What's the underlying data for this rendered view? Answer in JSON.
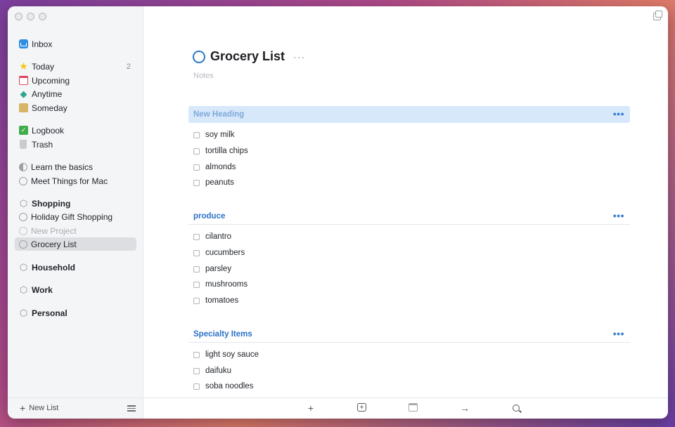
{
  "sidebar": {
    "items": [
      {
        "label": "Inbox",
        "icon": "inbox-icon"
      },
      {
        "label": "Today",
        "icon": "star-icon",
        "count": "2"
      },
      {
        "label": "Upcoming",
        "icon": "calendar-icon"
      },
      {
        "label": "Anytime",
        "icon": "stack-icon"
      },
      {
        "label": "Someday",
        "icon": "box-icon"
      },
      {
        "label": "Logbook",
        "icon": "logbook-icon"
      },
      {
        "label": "Trash",
        "icon": "trash-icon"
      },
      {
        "label": "Learn the basics",
        "icon": "progress-ring-icon"
      },
      {
        "label": "Meet Things for Mac",
        "icon": "ring-icon"
      },
      {
        "label": "Shopping",
        "icon": "cube-icon"
      },
      {
        "label": "Holiday Gift Shopping",
        "icon": "ring-icon"
      },
      {
        "label": "New Project",
        "icon": "ring-icon"
      },
      {
        "label": "Grocery List",
        "icon": "ring-icon"
      },
      {
        "label": "Household",
        "icon": "cube-icon"
      },
      {
        "label": "Work",
        "icon": "cube-icon"
      },
      {
        "label": "Personal",
        "icon": "cube-icon"
      }
    ],
    "footer": {
      "new_list": "New List",
      "plus": "+"
    }
  },
  "main": {
    "title": "Grocery List",
    "title_more": "···",
    "notes_placeholder": "Notes",
    "heading_more": "•••",
    "sections": [
      {
        "heading": "New Heading",
        "items": [
          "soy milk",
          "tortilla chips",
          "almonds",
          "peanuts"
        ]
      },
      {
        "heading": "produce",
        "items": [
          "cilantro",
          "cucumbers",
          "parsley",
          "mushrooms",
          "tomatoes"
        ]
      },
      {
        "heading": "Specialty Items",
        "items": [
          "light soy sauce",
          "daifuku",
          "soba noodles"
        ]
      }
    ]
  },
  "toolbar": {
    "add": "+",
    "add_heading": "+",
    "move": "→"
  },
  "colors": {
    "accent": "#2a72c8",
    "selection": "#d7e8fb",
    "sidebar_bg": "#f4f5f7"
  }
}
